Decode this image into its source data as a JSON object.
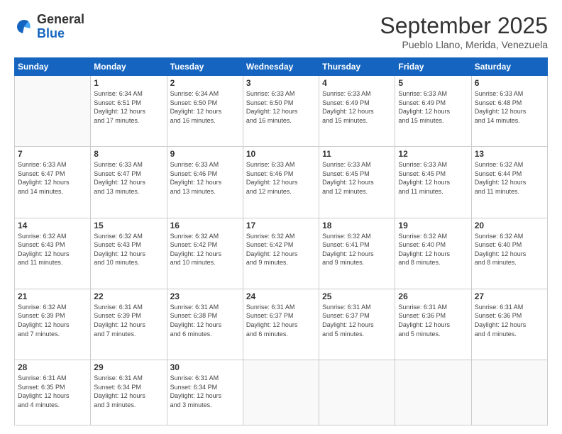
{
  "header": {
    "logo_general": "General",
    "logo_blue": "Blue",
    "month_year": "September 2025",
    "location": "Pueblo Llano, Merida, Venezuela"
  },
  "days_of_week": [
    "Sunday",
    "Monday",
    "Tuesday",
    "Wednesday",
    "Thursday",
    "Friday",
    "Saturday"
  ],
  "weeks": [
    [
      {
        "day": "",
        "info": ""
      },
      {
        "day": "1",
        "info": "Sunrise: 6:34 AM\nSunset: 6:51 PM\nDaylight: 12 hours\nand 17 minutes."
      },
      {
        "day": "2",
        "info": "Sunrise: 6:34 AM\nSunset: 6:50 PM\nDaylight: 12 hours\nand 16 minutes."
      },
      {
        "day": "3",
        "info": "Sunrise: 6:33 AM\nSunset: 6:50 PM\nDaylight: 12 hours\nand 16 minutes."
      },
      {
        "day": "4",
        "info": "Sunrise: 6:33 AM\nSunset: 6:49 PM\nDaylight: 12 hours\nand 15 minutes."
      },
      {
        "day": "5",
        "info": "Sunrise: 6:33 AM\nSunset: 6:49 PM\nDaylight: 12 hours\nand 15 minutes."
      },
      {
        "day": "6",
        "info": "Sunrise: 6:33 AM\nSunset: 6:48 PM\nDaylight: 12 hours\nand 14 minutes."
      }
    ],
    [
      {
        "day": "7",
        "info": "Sunrise: 6:33 AM\nSunset: 6:47 PM\nDaylight: 12 hours\nand 14 minutes."
      },
      {
        "day": "8",
        "info": "Sunrise: 6:33 AM\nSunset: 6:47 PM\nDaylight: 12 hours\nand 13 minutes."
      },
      {
        "day": "9",
        "info": "Sunrise: 6:33 AM\nSunset: 6:46 PM\nDaylight: 12 hours\nand 13 minutes."
      },
      {
        "day": "10",
        "info": "Sunrise: 6:33 AM\nSunset: 6:46 PM\nDaylight: 12 hours\nand 12 minutes."
      },
      {
        "day": "11",
        "info": "Sunrise: 6:33 AM\nSunset: 6:45 PM\nDaylight: 12 hours\nand 12 minutes."
      },
      {
        "day": "12",
        "info": "Sunrise: 6:33 AM\nSunset: 6:45 PM\nDaylight: 12 hours\nand 11 minutes."
      },
      {
        "day": "13",
        "info": "Sunrise: 6:32 AM\nSunset: 6:44 PM\nDaylight: 12 hours\nand 11 minutes."
      }
    ],
    [
      {
        "day": "14",
        "info": "Sunrise: 6:32 AM\nSunset: 6:43 PM\nDaylight: 12 hours\nand 11 minutes."
      },
      {
        "day": "15",
        "info": "Sunrise: 6:32 AM\nSunset: 6:43 PM\nDaylight: 12 hours\nand 10 minutes."
      },
      {
        "day": "16",
        "info": "Sunrise: 6:32 AM\nSunset: 6:42 PM\nDaylight: 12 hours\nand 10 minutes."
      },
      {
        "day": "17",
        "info": "Sunrise: 6:32 AM\nSunset: 6:42 PM\nDaylight: 12 hours\nand 9 minutes."
      },
      {
        "day": "18",
        "info": "Sunrise: 6:32 AM\nSunset: 6:41 PM\nDaylight: 12 hours\nand 9 minutes."
      },
      {
        "day": "19",
        "info": "Sunrise: 6:32 AM\nSunset: 6:40 PM\nDaylight: 12 hours\nand 8 minutes."
      },
      {
        "day": "20",
        "info": "Sunrise: 6:32 AM\nSunset: 6:40 PM\nDaylight: 12 hours\nand 8 minutes."
      }
    ],
    [
      {
        "day": "21",
        "info": "Sunrise: 6:32 AM\nSunset: 6:39 PM\nDaylight: 12 hours\nand 7 minutes."
      },
      {
        "day": "22",
        "info": "Sunrise: 6:31 AM\nSunset: 6:39 PM\nDaylight: 12 hours\nand 7 minutes."
      },
      {
        "day": "23",
        "info": "Sunrise: 6:31 AM\nSunset: 6:38 PM\nDaylight: 12 hours\nand 6 minutes."
      },
      {
        "day": "24",
        "info": "Sunrise: 6:31 AM\nSunset: 6:37 PM\nDaylight: 12 hours\nand 6 minutes."
      },
      {
        "day": "25",
        "info": "Sunrise: 6:31 AM\nSunset: 6:37 PM\nDaylight: 12 hours\nand 5 minutes."
      },
      {
        "day": "26",
        "info": "Sunrise: 6:31 AM\nSunset: 6:36 PM\nDaylight: 12 hours\nand 5 minutes."
      },
      {
        "day": "27",
        "info": "Sunrise: 6:31 AM\nSunset: 6:36 PM\nDaylight: 12 hours\nand 4 minutes."
      }
    ],
    [
      {
        "day": "28",
        "info": "Sunrise: 6:31 AM\nSunset: 6:35 PM\nDaylight: 12 hours\nand 4 minutes."
      },
      {
        "day": "29",
        "info": "Sunrise: 6:31 AM\nSunset: 6:34 PM\nDaylight: 12 hours\nand 3 minutes."
      },
      {
        "day": "30",
        "info": "Sunrise: 6:31 AM\nSunset: 6:34 PM\nDaylight: 12 hours\nand 3 minutes."
      },
      {
        "day": "",
        "info": ""
      },
      {
        "day": "",
        "info": ""
      },
      {
        "day": "",
        "info": ""
      },
      {
        "day": "",
        "info": ""
      }
    ]
  ]
}
